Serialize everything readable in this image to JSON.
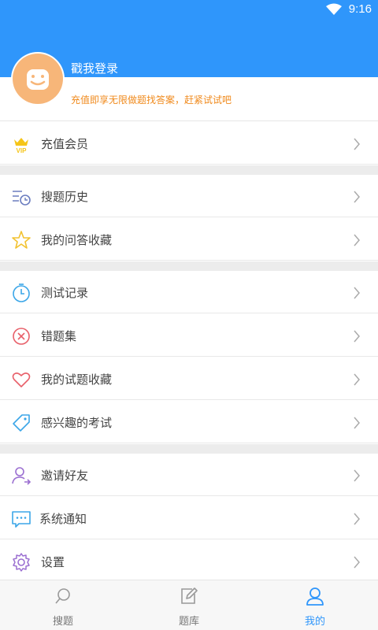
{
  "status_bar": {
    "time": "9:16"
  },
  "profile": {
    "login_text": "戳我登录",
    "promo_text": "充值即享无限做题找答案，赶紧试试吧"
  },
  "menu": {
    "vip": "充值会员",
    "search_history": "搜题历史",
    "qa_favorites": "我的问答收藏",
    "test_records": "测试记录",
    "wrong_questions": "错题集",
    "question_favorites": "我的试题收藏",
    "interested_exams": "感兴趣的考试",
    "invite_friends": "邀请好友",
    "system_notifications": "系统通知",
    "settings": "设置"
  },
  "tabs": {
    "search": "搜题",
    "question_bank": "题库",
    "mine": "我的"
  },
  "colors": {
    "primary": "#2f96fb",
    "promo": "#f08a1c"
  }
}
